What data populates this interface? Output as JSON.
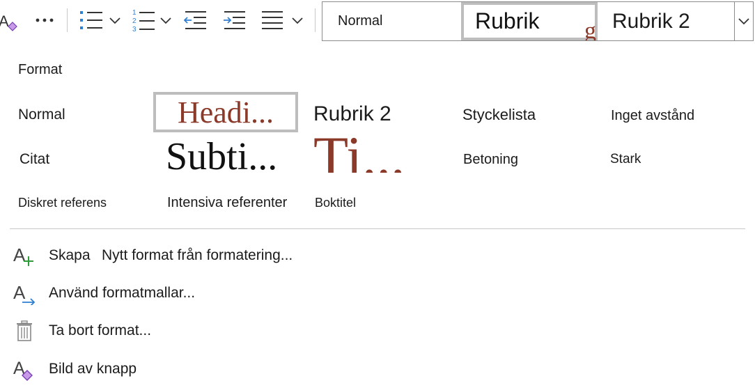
{
  "ribbon": {
    "icons": [
      "clear-format-icon",
      "more-icon",
      "bullets-icon",
      "numbering-icon",
      "decrease-indent-icon",
      "increase-indent-icon",
      "align-icon"
    ],
    "gallery": {
      "items": [
        "Normal",
        "Rubrik",
        "Rubrik 2"
      ],
      "rubrik_tail": "g"
    }
  },
  "format": {
    "title": "Format",
    "styles": {
      "normal": "Normal",
      "heading": "Headi...",
      "rubrik2": "Rubrik 2",
      "styckelista": "Styckelista",
      "inget_avstand": "Inget avstånd",
      "citat": "Citat",
      "subtitle": "Subti...",
      "title": "Ti...",
      "betoning": "Betoning",
      "stark": "Stark",
      "diskret_referens": "Diskret referens",
      "intensiva_referenter": "Intensiva referenter",
      "boktitel": "Boktitel"
    }
  },
  "menu": {
    "create_label": "Skapa",
    "create_sub": "Nytt format från formatering...",
    "apply": "Använd formatmallar...",
    "remove": "Ta bort format...",
    "button_image": "Bild av knapp"
  },
  "colors": {
    "accent_blue": "#2f7fd1",
    "heading_red": "#8b3a2a",
    "selection_gray": "#bdbdbd",
    "create_green": "#2e9e3a",
    "eraser_purple": "#a36ad6"
  }
}
